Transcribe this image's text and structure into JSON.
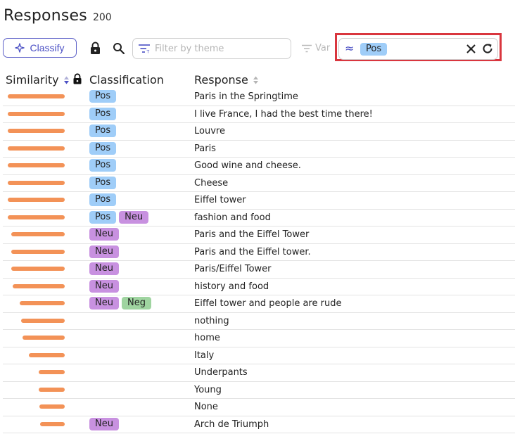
{
  "header": {
    "title": "Responses",
    "count": "200"
  },
  "toolbar": {
    "classify_label": "Classify",
    "filter_placeholder": "Filter by theme",
    "var_label": "Var",
    "similarity_filter_chip": "Pos"
  },
  "columns": {
    "similarity": "Similarity",
    "classification": "Classification",
    "response": "Response"
  },
  "colors": {
    "accent": "#4a4fc4",
    "bar": "#f39257",
    "pos": "#9fcdf8",
    "neu": "#c891e0",
    "neg": "#9fd4a0",
    "highlight": "#d9363e"
  },
  "rows": [
    {
      "similarity": 0.97,
      "tags": [
        "Pos"
      ],
      "response": "Paris in the Springtime"
    },
    {
      "similarity": 0.97,
      "tags": [
        "Pos"
      ],
      "response": "I live France, I had the best time there!"
    },
    {
      "similarity": 0.97,
      "tags": [
        "Pos"
      ],
      "response": "Louvre"
    },
    {
      "similarity": 0.97,
      "tags": [
        "Pos"
      ],
      "response": "Paris"
    },
    {
      "similarity": 0.97,
      "tags": [
        "Pos"
      ],
      "response": "Good wine and cheese."
    },
    {
      "similarity": 0.97,
      "tags": [
        "Pos"
      ],
      "response": "Cheese"
    },
    {
      "similarity": 0.97,
      "tags": [
        "Pos"
      ],
      "response": "Eiffel tower"
    },
    {
      "similarity": 0.97,
      "tags": [
        "Pos",
        "Neu"
      ],
      "response": "fashion and food"
    },
    {
      "similarity": 0.9,
      "tags": [
        "Neu"
      ],
      "response": "Paris and the Eiffel Tower"
    },
    {
      "similarity": 0.9,
      "tags": [
        "Neu"
      ],
      "response": "Paris and the Eiffel tower."
    },
    {
      "similarity": 0.9,
      "tags": [
        "Neu"
      ],
      "response": "Paris/Eiffel Tower"
    },
    {
      "similarity": 0.88,
      "tags": [
        "Neu"
      ],
      "response": "history and food"
    },
    {
      "similarity": 0.76,
      "tags": [
        "Neu",
        "Neg"
      ],
      "response": "Eiffel tower and people are rude"
    },
    {
      "similarity": 0.74,
      "tags": [],
      "response": "nothing"
    },
    {
      "similarity": 0.71,
      "tags": [],
      "response": "home"
    },
    {
      "similarity": 0.61,
      "tags": [],
      "response": "Italy"
    },
    {
      "similarity": 0.44,
      "tags": [],
      "response": "Underpants"
    },
    {
      "similarity": 0.44,
      "tags": [],
      "response": "Young"
    },
    {
      "similarity": 0.43,
      "tags": [],
      "response": "None"
    },
    {
      "similarity": 0.42,
      "tags": [
        "Neu"
      ],
      "response": "Arch de Triumph"
    }
  ]
}
